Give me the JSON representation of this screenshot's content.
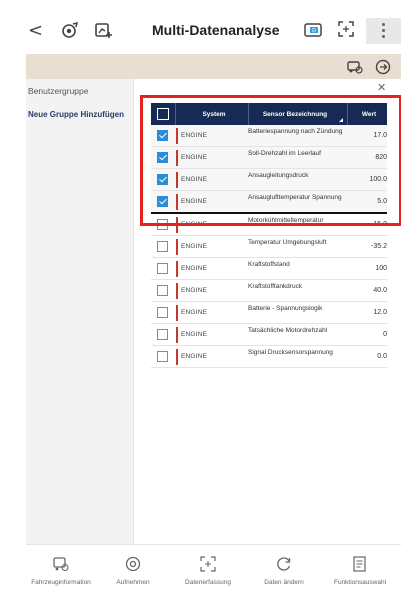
{
  "header": {
    "title": "Multi-Datenanalyse",
    "icons": [
      "back-icon",
      "recorder-icon",
      "graph-settings-icon",
      "data-source-icon",
      "fullscreen-icon",
      "more-icon"
    ]
  },
  "toolbar": {
    "icons": [
      "vehicle-settings-icon",
      "next-icon"
    ]
  },
  "left_panel": {
    "group_label": "Benutzergruppe",
    "close_symbol": "✕",
    "add_group_label": "Neue Gruppe Hinzufügen"
  },
  "table": {
    "headers": {
      "system": "System",
      "sensor": "Sensor Bezeichnung",
      "wert": "Wert"
    },
    "rows": [
      {
        "checked": true,
        "system": "ENGINE",
        "sensor": "Batteriespannung nach Zündung",
        "value": "17.0"
      },
      {
        "checked": true,
        "system": "ENGINE",
        "sensor": "Soll-Drehzahl im Leerlauf",
        "value": "820"
      },
      {
        "checked": true,
        "system": "ENGINE",
        "sensor": "Ansaugleitungsdruck",
        "value": "100.0"
      },
      {
        "checked": true,
        "system": "ENGINE",
        "sensor": "Ansauglufttemperatur Spannung",
        "value": "5.0"
      },
      {
        "checked": false,
        "system": "ENGINE",
        "sensor": "Motorkühlmitteltemperatur",
        "value": "15.0"
      },
      {
        "checked": false,
        "system": "ENGINE",
        "sensor": "Temperatur Umgebungsluft",
        "value": "-35.2"
      },
      {
        "checked": false,
        "system": "ENGINE",
        "sensor": "Kraftstoffstand",
        "value": "100"
      },
      {
        "checked": false,
        "system": "ENGINE",
        "sensor": "Kraftstofftankdruck",
        "value": "40.0"
      },
      {
        "checked": false,
        "system": "ENGINE",
        "sensor": "Batterie - Spannungslogik",
        "value": "12.0"
      },
      {
        "checked": false,
        "system": "ENGINE",
        "sensor": "Tatsächliche Motordrehzahl",
        "value": "0"
      },
      {
        "checked": false,
        "system": "ENGINE",
        "sensor": "Signal Drucksensorspannung",
        "value": "0.0"
      }
    ]
  },
  "bottom_nav": [
    {
      "label": "Fahrzeuginformation",
      "icon": "car-settings-icon"
    },
    {
      "label": "Aufnehmen",
      "icon": "record-icon"
    },
    {
      "label": "Datenerfassung",
      "icon": "capture-icon"
    },
    {
      "label": "Daten ändern",
      "icon": "refresh-icon"
    },
    {
      "label": "Funktionsauswahl",
      "icon": "document-icon"
    }
  ],
  "colors": {
    "header_bg": "#162a55",
    "toolbar_bg": "#e8dfd2",
    "checkbox_checked": "#2a8ed6",
    "system_marker": "#c0392b",
    "highlight_box": "#e32222"
  }
}
